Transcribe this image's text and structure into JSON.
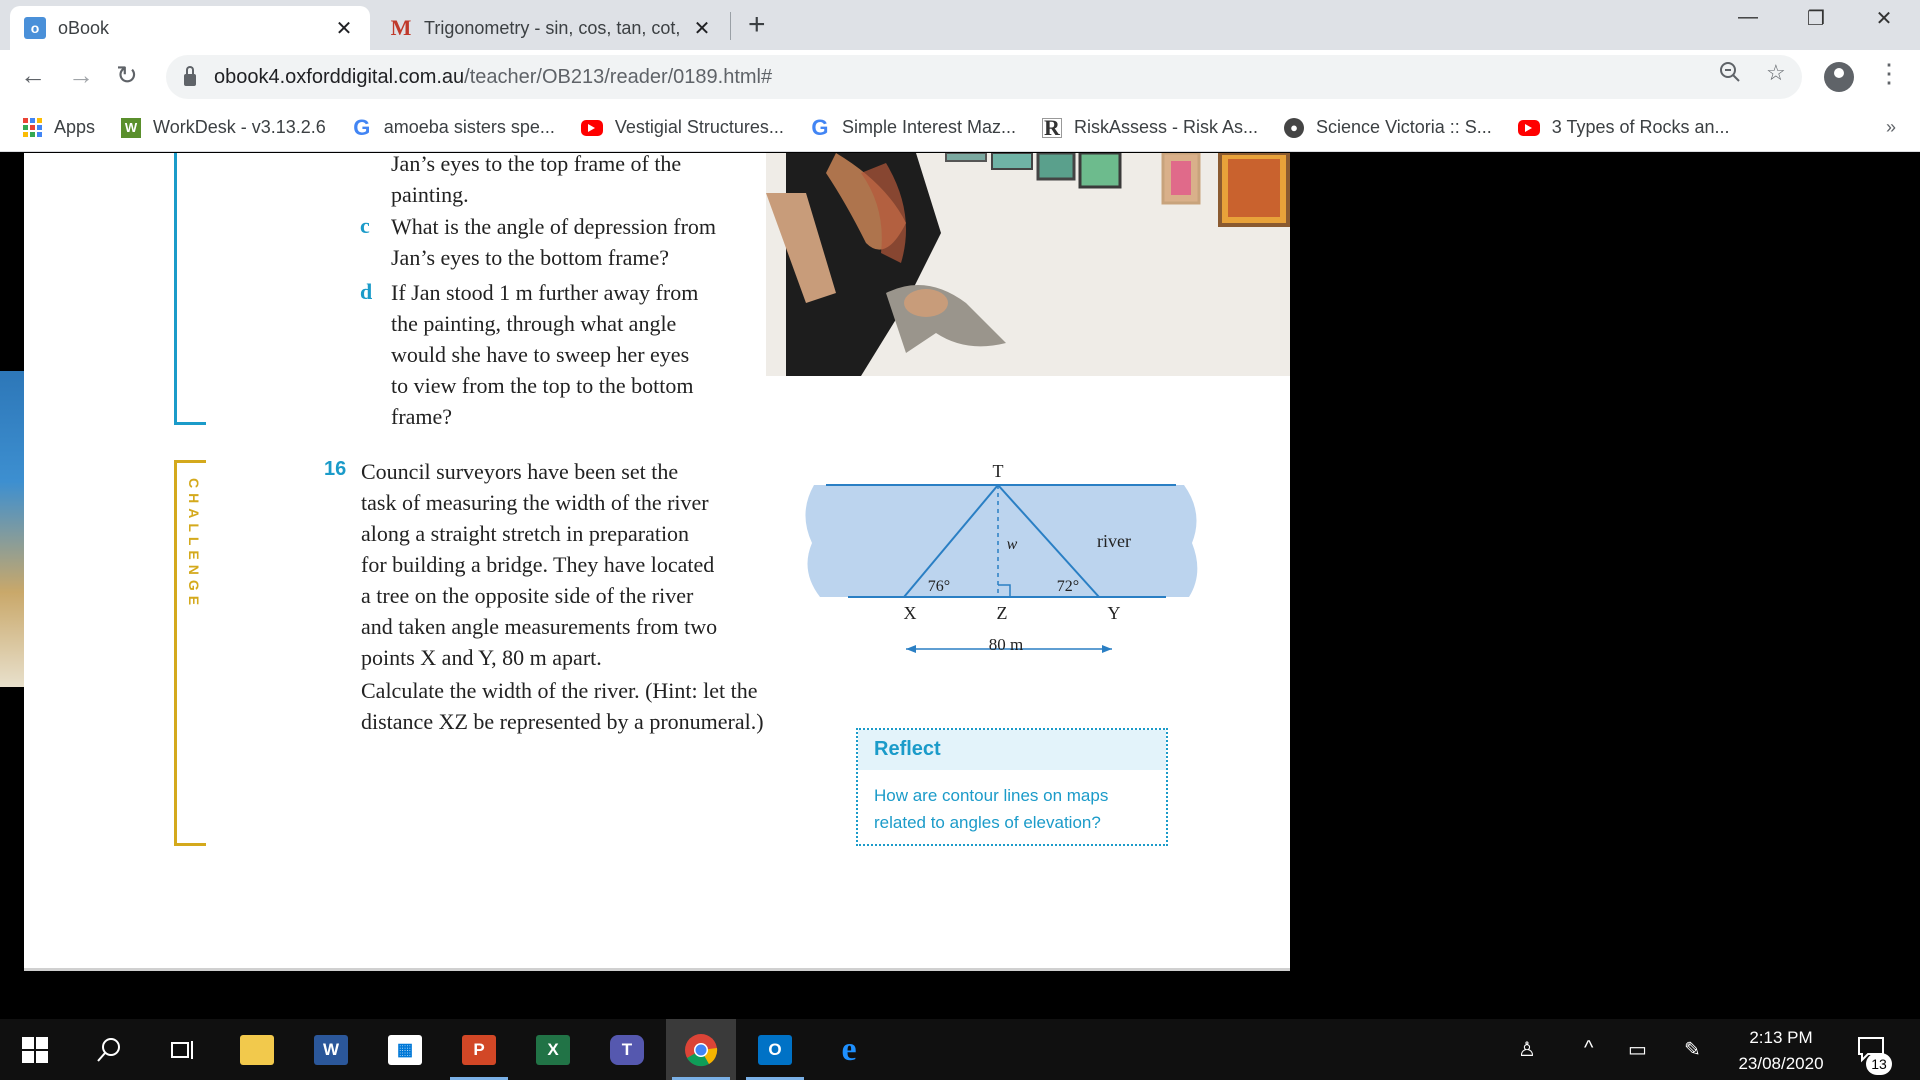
{
  "tabs": [
    {
      "title": "oBook",
      "active": true
    },
    {
      "title": "Trigonometry - sin, cos, tan, cot, "
    }
  ],
  "toolbar": {
    "url_host": "obook4.oxforddigital.com.au",
    "url_path": "/teacher/OB213/reader/0189.html#"
  },
  "bookmarks": [
    {
      "label": "Apps",
      "icon": "apps-grid-icon"
    },
    {
      "label": "WorkDesk - v3.13.2.6",
      "icon": "workdesk-icon"
    },
    {
      "label": "amoeba sisters spe...",
      "icon": "google-icon"
    },
    {
      "label": "Vestigial Structures...",
      "icon": "youtube-icon"
    },
    {
      "label": "Simple Interest Maz...",
      "icon": "google-icon"
    },
    {
      "label": "RiskAssess - Risk As...",
      "icon": "riskassess-icon"
    },
    {
      "label": "Science Victoria :: S...",
      "icon": "science-victoria-icon"
    },
    {
      "label": "3 Types of Rocks an...",
      "icon": "youtube-icon"
    }
  ],
  "book": {
    "q15_tail_lines": [
      "Jan’s eyes to the top frame of the",
      "painting."
    ],
    "q15c_letter": "c",
    "q15c_lines": [
      "What is the angle of depression from",
      "Jan’s eyes to the bottom frame?"
    ],
    "q15d_letter": "d",
    "q15d_lines": [
      "If Jan stood 1 m further away from",
      "the painting, through what angle",
      "would she have to sweep her eyes",
      "to view from the top to the bottom",
      "frame?"
    ],
    "challenge_label": "CHALLENGE",
    "q16_number": "16",
    "q16_lines": [
      "Council surveyors have been set the",
      "task of measuring the width of the river",
      "along a straight stretch in preparation",
      "for building a bridge. They have located",
      "a tree on the opposite side of the river",
      "and taken angle measurements from two",
      "points X and Y, 80 m apart."
    ],
    "q16_calc_lines": [
      "Calculate the width of the river. (Hint: let the",
      "distance XZ be represented by a pronumeral.)"
    ],
    "diagram": {
      "label_T": "T",
      "label_river": "river",
      "label_w": "w",
      "angle_X": "76°",
      "angle_Y": "72°",
      "label_X": "X",
      "label_Z": "Z",
      "label_Y": "Y",
      "distance": "80 m"
    },
    "reflect": {
      "heading": "Reflect",
      "body_lines": [
        "How are contour lines on maps",
        "related to angles of elevation?"
      ]
    }
  },
  "taskbar": {
    "apps": [
      "start",
      "search",
      "task-view",
      "file-explorer",
      "word",
      "store",
      "powerpoint",
      "excel",
      "teams",
      "chrome",
      "outlook",
      "edge"
    ],
    "active_app": "chrome",
    "time": "2:13 PM",
    "date": "23/08/2020",
    "notifications": "13"
  },
  "colors": {
    "accent_blue": "#1b9bc9",
    "challenge_gold": "#d4a91c",
    "river_fill": "#bcd4ee"
  }
}
